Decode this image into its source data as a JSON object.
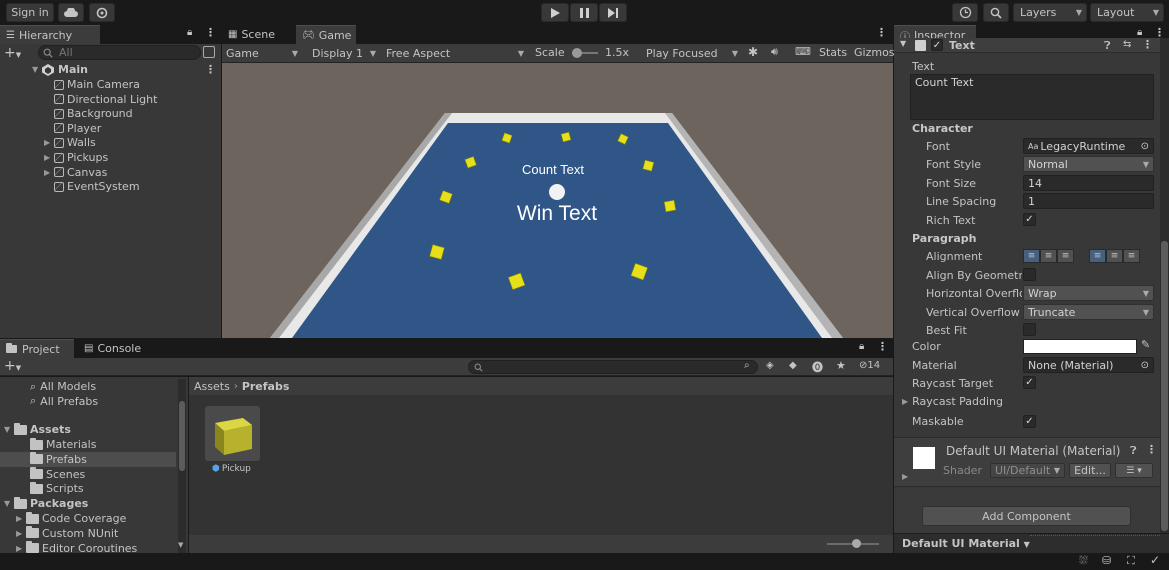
{
  "toolbar": {
    "sign_in": "Sign in",
    "layers": "Layers",
    "layout": "Layout"
  },
  "hierarchy": {
    "tab": "Hierarchy",
    "search_placeholder": "All",
    "scene": "Main",
    "items": [
      "Main Camera",
      "Directional Light",
      "Background",
      "Player",
      "Walls",
      "Pickups",
      "Canvas",
      "EventSystem"
    ]
  },
  "scene_tab": "Scene",
  "game": {
    "tab": "Game",
    "mode": "Game",
    "display": "Display 1",
    "aspect": "Free Aspect",
    "scale_label": "Scale",
    "scale_value": "1.5x",
    "play_mode": "Play Focused",
    "stats": "Stats",
    "gizmos": "Gizmos",
    "count_text": "Count Text",
    "win_text": "Win Text"
  },
  "project": {
    "tab": "Project",
    "console_tab": "Console",
    "favorites": [
      "All Models",
      "All Prefabs"
    ],
    "assets_label": "Assets",
    "asset_folders": [
      "Materials",
      "Prefabs",
      "Scenes",
      "Scripts"
    ],
    "packages_label": "Packages",
    "packages": [
      "Code Coverage",
      "Custom NUnit",
      "Editor Coroutines"
    ],
    "breadcrumb_root": "Assets",
    "breadcrumb_current": "Prefabs",
    "hidden_count": "14",
    "prefab_name": "Pickup"
  },
  "inspector": {
    "tab": "Inspector",
    "component": "Text",
    "text_label": "Text",
    "text_value": "Count Text",
    "character": "Character",
    "font_label": "Font",
    "font_value": "LegacyRuntime",
    "font_style_label": "Font Style",
    "font_style_value": "Normal",
    "font_size_label": "Font Size",
    "font_size_value": "14",
    "line_spacing_label": "Line Spacing",
    "line_spacing_value": "1",
    "rich_text_label": "Rich Text",
    "paragraph": "Paragraph",
    "alignment_label": "Alignment",
    "align_by_geometry_label": "Align By Geometry",
    "horizontal_overflow_label": "Horizontal Overflow",
    "horizontal_overflow_value": "Wrap",
    "vertical_overflow_label": "Vertical Overflow",
    "vertical_overflow_value": "Truncate",
    "best_fit_label": "Best Fit",
    "color_label": "Color",
    "color_value": "#ffffff",
    "material_label": "Material",
    "material_value": "None (Material)",
    "raycast_target_label": "Raycast Target",
    "raycast_padding_label": "Raycast Padding",
    "maskable_label": "Maskable",
    "material_block_title": "Default UI Material (Material)",
    "shader_label": "Shader",
    "shader_value": "UI/Default",
    "edit_button": "Edit...",
    "add_component": "Add Component",
    "footer_label": "Default UI Material"
  },
  "colors": {
    "accent": "#3a72b0",
    "floor": "#2f5686",
    "wall": "#e0e0e0",
    "background": "#6d645d",
    "pickup": "#e6e01a"
  }
}
